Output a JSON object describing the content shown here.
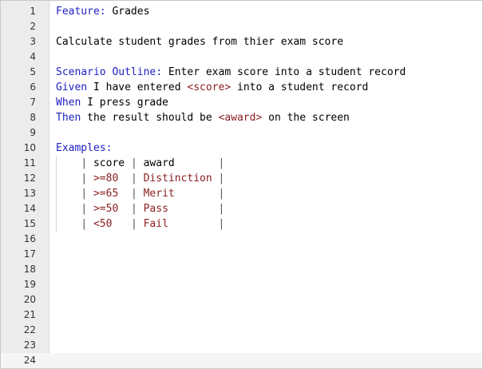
{
  "editor": {
    "lines": [
      {
        "num": "1",
        "parts": [
          {
            "t": "Feature:",
            "c": "kw"
          },
          {
            "t": " Grades"
          }
        ]
      },
      {
        "num": "2",
        "parts": []
      },
      {
        "num": "3",
        "parts": [
          {
            "t": "Calculate student grades from thier exam score"
          }
        ]
      },
      {
        "num": "4",
        "parts": []
      },
      {
        "num": "5",
        "parts": [
          {
            "t": "Scenario Outline:",
            "c": "kw"
          },
          {
            "t": " Enter exam score into a student record"
          }
        ]
      },
      {
        "num": "6",
        "parts": [
          {
            "t": "Given",
            "c": "kw"
          },
          {
            "t": " I have entered "
          },
          {
            "t": "<score>",
            "c": "ph"
          },
          {
            "t": " into a student record"
          }
        ]
      },
      {
        "num": "7",
        "parts": [
          {
            "t": "When",
            "c": "kw"
          },
          {
            "t": " I press grade"
          }
        ]
      },
      {
        "num": "8",
        "parts": [
          {
            "t": "Then",
            "c": "kw"
          },
          {
            "t": " the result should be "
          },
          {
            "t": "<award>",
            "c": "ph"
          },
          {
            "t": " on the screen"
          }
        ]
      },
      {
        "num": "9",
        "parts": []
      },
      {
        "num": "10",
        "parts": [
          {
            "t": "Examples:",
            "c": "kw"
          }
        ]
      },
      {
        "num": "11",
        "parts": [
          {
            "t": "    "
          },
          {
            "t": "|",
            "c": "pipe"
          },
          {
            "t": " score "
          },
          {
            "t": "|",
            "c": "pipe"
          },
          {
            "t": " award       "
          },
          {
            "t": "|",
            "c": "pipe"
          }
        ]
      },
      {
        "num": "12",
        "parts": [
          {
            "t": "    "
          },
          {
            "t": "|",
            "c": "pipe"
          },
          {
            "t": " >=80  ",
            "c": "ph"
          },
          {
            "t": "|",
            "c": "pipe"
          },
          {
            "t": " Distinction ",
            "c": "ph"
          },
          {
            "t": "|",
            "c": "pipe"
          }
        ]
      },
      {
        "num": "13",
        "parts": [
          {
            "t": "    "
          },
          {
            "t": "|",
            "c": "pipe"
          },
          {
            "t": " >=65  ",
            "c": "ph"
          },
          {
            "t": "|",
            "c": "pipe"
          },
          {
            "t": " Merit       ",
            "c": "ph"
          },
          {
            "t": "|",
            "c": "pipe"
          }
        ]
      },
      {
        "num": "14",
        "parts": [
          {
            "t": "    "
          },
          {
            "t": "|",
            "c": "pipe"
          },
          {
            "t": " >=50  ",
            "c": "ph"
          },
          {
            "t": "|",
            "c": "pipe"
          },
          {
            "t": " Pass        ",
            "c": "ph"
          },
          {
            "t": "|",
            "c": "pipe"
          }
        ]
      },
      {
        "num": "15",
        "parts": [
          {
            "t": "    "
          },
          {
            "t": "|",
            "c": "pipe"
          },
          {
            "t": " <50   ",
            "c": "ph"
          },
          {
            "t": "|",
            "c": "pipe"
          },
          {
            "t": " Fail        ",
            "c": "ph"
          },
          {
            "t": "|",
            "c": "pipe"
          }
        ]
      },
      {
        "num": "16",
        "parts": []
      },
      {
        "num": "17",
        "parts": []
      },
      {
        "num": "18",
        "parts": []
      },
      {
        "num": "19",
        "parts": []
      },
      {
        "num": "20",
        "parts": []
      },
      {
        "num": "21",
        "parts": []
      },
      {
        "num": "22",
        "parts": []
      },
      {
        "num": "23",
        "parts": []
      },
      {
        "num": "24",
        "parts": [],
        "current": true
      }
    ]
  },
  "colors": {
    "keyword": "#2020c0",
    "placeholder": "#8b2020",
    "text": "#000000",
    "gutter": "#ececec"
  }
}
